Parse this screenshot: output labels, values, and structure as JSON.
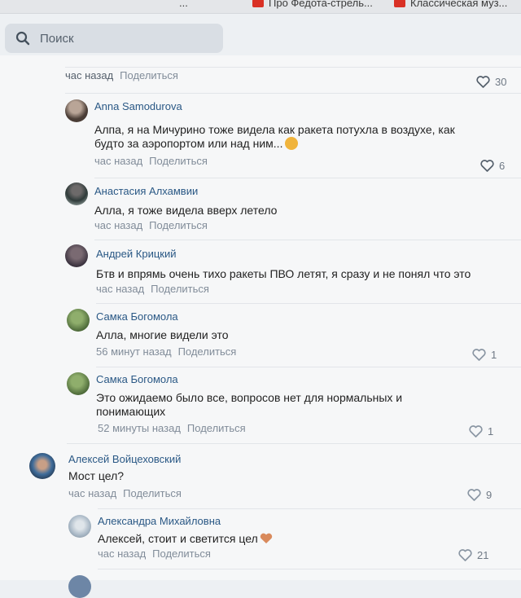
{
  "bookmarks": [
    {
      "label": "...",
      "icon": "page-icon"
    },
    {
      "label": "Про Федота-стрель...",
      "icon": "youtube-icon"
    },
    {
      "label": "Классическая муз...",
      "icon": "youtube-icon"
    }
  ],
  "search": {
    "placeholder": "Поиск",
    "icon": "search-icon"
  },
  "top_meta": {
    "time": "час назад",
    "share": "Поделиться",
    "likes": "30"
  },
  "comments": [
    {
      "author": "Anna Samodurova",
      "lines": [
        "Алпа, я на Мичурино тоже видела как ракета потухла в воздухе, как",
        "будто за аэропортом или над ним..."
      ],
      "time": "час назад",
      "share": "Поделиться",
      "likes": "6",
      "emoji": "astonished-face-emoji"
    },
    {
      "author": "Анастасия Алхамвии",
      "lines": [
        "Алла, я тоже видела вверх летело"
      ],
      "time": "час назад",
      "share": "Поделиться",
      "likes": ""
    },
    {
      "author": "Андрей Крицкий",
      "lines": [
        "Бтв и впрямь очень тихо ракеты ПВО летят, я сразу и не понял что это"
      ],
      "time": "час назад",
      "share": "Поделиться",
      "likes": ""
    },
    {
      "author": "Самка Богомола",
      "lines": [
        "Алла, многие видели это"
      ],
      "time": "56 минут назад",
      "share": "Поделиться",
      "likes": "1"
    },
    {
      "author": "Самка Богомола",
      "lines": [
        "Это ожидаемо было все, вопросов нет для нормальных и",
        "понимающих"
      ],
      "time": "52 минуты назад",
      "share": "Поделиться",
      "likes": "1"
    },
    {
      "author": "Алексей Войцеховский",
      "lines": [
        "Мост цел?"
      ],
      "time": "час назад",
      "share": "Поделиться",
      "likes": "9"
    },
    {
      "author": "Александра Михайловна",
      "lines": [
        "Алексей, стоит и светится цел"
      ],
      "time": "час назад",
      "share": "Поделиться",
      "likes": "21",
      "emoji": "orange-heart-emoji"
    }
  ],
  "colors": {
    "accent": "#2a5885",
    "meta": "#818c99",
    "search_bg": "#d9dee4",
    "page_bg": "#f6f7f8"
  }
}
